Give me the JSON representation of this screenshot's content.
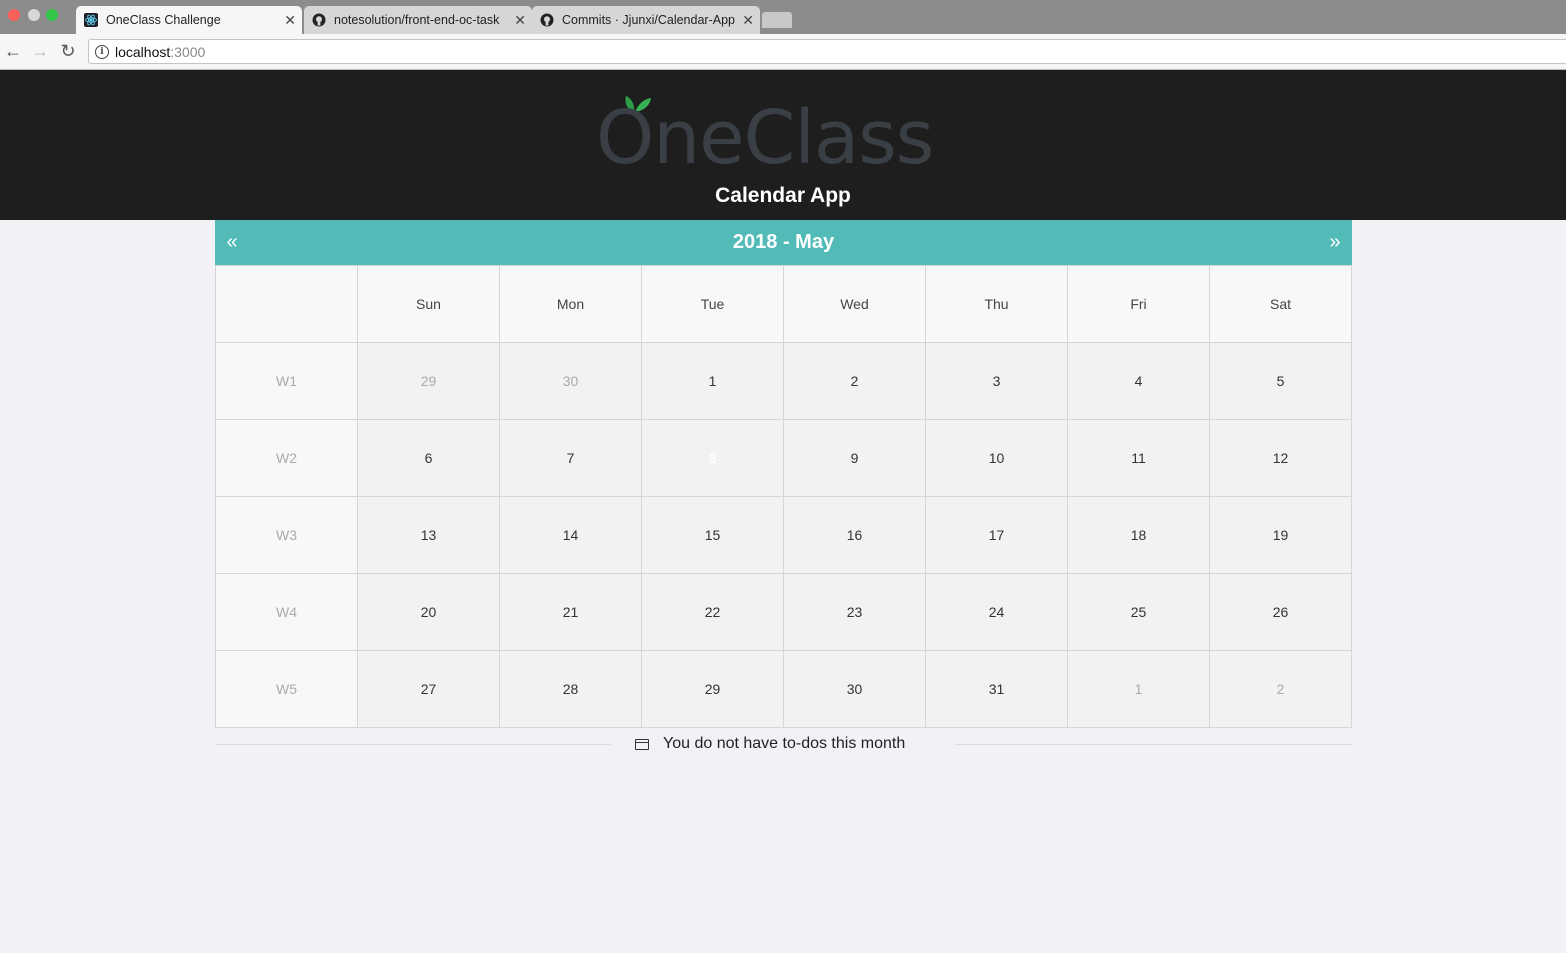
{
  "browser": {
    "tabs": [
      {
        "title": "OneClass Challenge",
        "icon": "react-icon",
        "active": true
      },
      {
        "title": "notesolution/front-end-oc-task",
        "icon": "github-icon",
        "active": false
      },
      {
        "title": "Commits · Jjunxi/Calendar-App",
        "icon": "github-icon",
        "active": false
      }
    ],
    "url_host": "localhost",
    "url_port": ":3000"
  },
  "header": {
    "logo_text": "OneClass",
    "app_title": "Calendar App"
  },
  "calendar": {
    "title": "2018 - May",
    "prev_label": "«",
    "next_label": "»",
    "weekdays": [
      "Sun",
      "Mon",
      "Tue",
      "Wed",
      "Thu",
      "Fri",
      "Sat"
    ],
    "weeks": [
      {
        "label": "W1",
        "days": [
          "29",
          "30",
          "1",
          "2",
          "3",
          "4",
          "5"
        ]
      },
      {
        "label": "W2",
        "days": [
          "6",
          "7",
          "8",
          "9",
          "10",
          "11",
          "12"
        ]
      },
      {
        "label": "W3",
        "days": [
          "13",
          "14",
          "15",
          "16",
          "17",
          "18",
          "19"
        ]
      },
      {
        "label": "W4",
        "days": [
          "20",
          "21",
          "22",
          "23",
          "24",
          "25",
          "26"
        ]
      },
      {
        "label": "W5",
        "days": [
          "27",
          "28",
          "29",
          "30",
          "31",
          "1",
          "2"
        ]
      }
    ],
    "selected_day": "8",
    "accent_color": "#52bbb7"
  },
  "todos": {
    "empty_message": "You do not have to-dos this month"
  }
}
